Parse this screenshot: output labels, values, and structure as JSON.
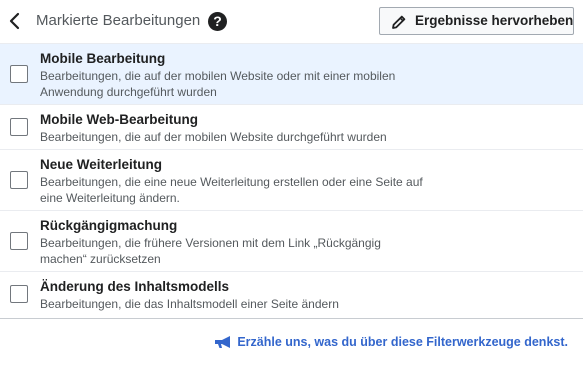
{
  "header": {
    "title": "Markierte Bearbeitungen",
    "help_glyph": "?",
    "highlight_button_label": "Ergebnisse hervorheben"
  },
  "filters": [
    {
      "title": "Mobile Bearbeitung",
      "description": "Bearbeitungen, die auf der mobilen Website oder mit einer mobilen Anwendung durchgeführt wurden",
      "checked": false,
      "highlighted": true
    },
    {
      "title": "Mobile Web-Bearbeitung",
      "description": "Bearbeitungen, die auf der mobilen Website durchgeführt wurden",
      "checked": false,
      "highlighted": false
    },
    {
      "title": "Neue Weiterleitung",
      "description": "Bearbeitungen, die eine neue Weiterleitung erstellen oder eine Seite auf eine Weiterleitung ändern.",
      "checked": false,
      "highlighted": false
    },
    {
      "title": "Rückgängigmachung",
      "description": "Bearbeitungen, die frühere Versionen mit dem Link „Rückgängig machen“ zurücksetzen",
      "checked": false,
      "highlighted": false
    },
    {
      "title": "Änderung des Inhaltsmodells",
      "description": "Bearbeitungen, die das Inhaltsmodell einer Seite ändern",
      "checked": false,
      "highlighted": false
    }
  ],
  "footer": {
    "feedback_link": "Erzähle uns, was du über diese Filterwerkzeuge denkst."
  },
  "colors": {
    "accent": "#3366cc",
    "highlight_row": "#eaf3ff"
  }
}
